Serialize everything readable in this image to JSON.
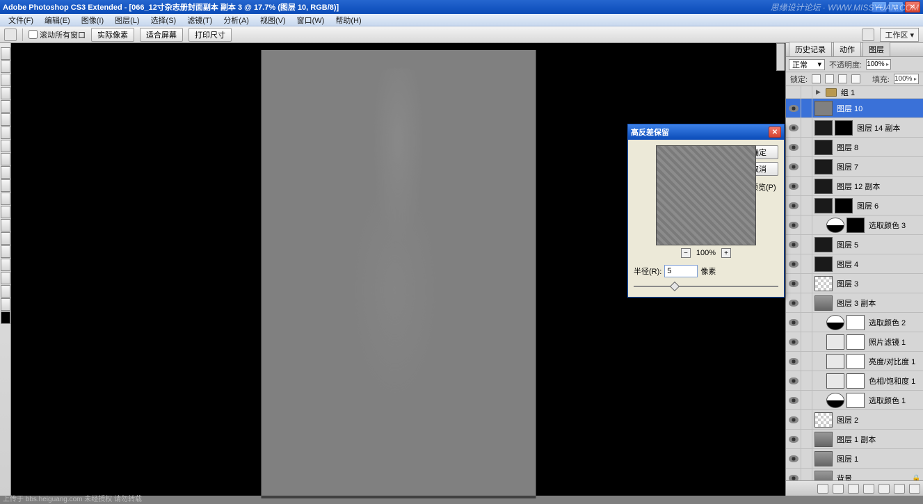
{
  "titlebar": {
    "text": "Adobe Photoshop CS3 Extended - [066_12寸杂志册封面副本 副本 3 @ 17.7% (图层 10, RGB/8)]"
  },
  "menu": {
    "items": [
      "文件(F)",
      "编辑(E)",
      "图像(I)",
      "图层(L)",
      "选择(S)",
      "滤镜(T)",
      "分析(A)",
      "视图(V)",
      "窗口(W)",
      "帮助(H)"
    ]
  },
  "options": {
    "scroll_all": "滚动所有窗口",
    "btn_actual": "实际像素",
    "btn_fit": "适合屏幕",
    "btn_print": "打印尺寸",
    "workspace_label": "工作区 ▾"
  },
  "panels": {
    "tabs": [
      "历史记录",
      "动作",
      "图层"
    ],
    "blend_mode": "正常",
    "opacity_label": "不透明度:",
    "opacity_value": "100%",
    "lock_label": "锁定:",
    "fill_label": "填充:",
    "fill_value": "100%"
  },
  "layers": [
    {
      "type": "group",
      "name": "组 1",
      "vis": false,
      "indent": 0
    },
    {
      "type": "layer",
      "name": "图层 10",
      "vis": true,
      "indent": 0,
      "thumbs": [
        "gray"
      ],
      "selected": true
    },
    {
      "type": "layer",
      "name": "图层 14 副本",
      "vis": true,
      "indent": 0,
      "thumbs": [
        "dark",
        "mask"
      ]
    },
    {
      "type": "layer",
      "name": "图层 8",
      "vis": true,
      "indent": 0,
      "thumbs": [
        "dark"
      ]
    },
    {
      "type": "layer",
      "name": "图层 7",
      "vis": true,
      "indent": 0,
      "thumbs": [
        "dark"
      ]
    },
    {
      "type": "layer",
      "name": "图层 12 副本",
      "vis": true,
      "indent": 0,
      "thumbs": [
        "dark"
      ]
    },
    {
      "type": "layer",
      "name": "图层 6",
      "vis": true,
      "indent": 0,
      "thumbs": [
        "dark",
        "mask"
      ]
    },
    {
      "type": "adj",
      "name": "选取颜色 3",
      "vis": true,
      "indent": 1,
      "thumbs": [
        "adj",
        "mask"
      ]
    },
    {
      "type": "layer",
      "name": "图层 5",
      "vis": true,
      "indent": 0,
      "thumbs": [
        "dark"
      ]
    },
    {
      "type": "layer",
      "name": "图层 4",
      "vis": true,
      "indent": 0,
      "thumbs": [
        "dark"
      ]
    },
    {
      "type": "layer",
      "name": "图层 3",
      "vis": true,
      "indent": 0,
      "thumbs": [
        "checker"
      ]
    },
    {
      "type": "layer",
      "name": "图层 3 副本",
      "vis": true,
      "indent": 0,
      "thumbs": [
        "photo"
      ]
    },
    {
      "type": "adj",
      "name": "选取颜色 2",
      "vis": true,
      "indent": 1,
      "thumbs": [
        "adj",
        "white"
      ]
    },
    {
      "type": "adj",
      "name": "照片滤镜 1",
      "vis": true,
      "indent": 1,
      "thumbs": [
        "adjbox",
        "white"
      ]
    },
    {
      "type": "adj",
      "name": "亮度/对比度 1",
      "vis": true,
      "indent": 1,
      "thumbs": [
        "adjbox",
        "white"
      ]
    },
    {
      "type": "adj",
      "name": "色相/饱和度 1",
      "vis": true,
      "indent": 1,
      "thumbs": [
        "adjbox",
        "white"
      ]
    },
    {
      "type": "adj",
      "name": "选取颜色 1",
      "vis": true,
      "indent": 1,
      "thumbs": [
        "adj",
        "white"
      ]
    },
    {
      "type": "layer",
      "name": "图层 2",
      "vis": true,
      "indent": 0,
      "thumbs": [
        "checker"
      ]
    },
    {
      "type": "layer",
      "name": "图层 1 副本",
      "vis": true,
      "indent": 0,
      "thumbs": [
        "photo"
      ]
    },
    {
      "type": "layer",
      "name": "图层 1",
      "vis": true,
      "indent": 0,
      "thumbs": [
        "photo"
      ]
    },
    {
      "type": "bg",
      "name": "背景",
      "vis": true,
      "indent": 0,
      "thumbs": [
        "photo"
      ],
      "locked": true
    }
  ],
  "dialog": {
    "title": "高反差保留",
    "ok": "确定",
    "cancel": "取消",
    "preview": "预览(P)",
    "zoom": "100%",
    "radius_label": "半径(R):",
    "radius_value": "5",
    "radius_unit": "像素"
  },
  "watermark": {
    "top_right": "思缘设计论坛 · WWW.MISSYUAN.COM",
    "bottom_left": "上传于 bbs.heiguang.com  未经授权  请勿转载"
  }
}
